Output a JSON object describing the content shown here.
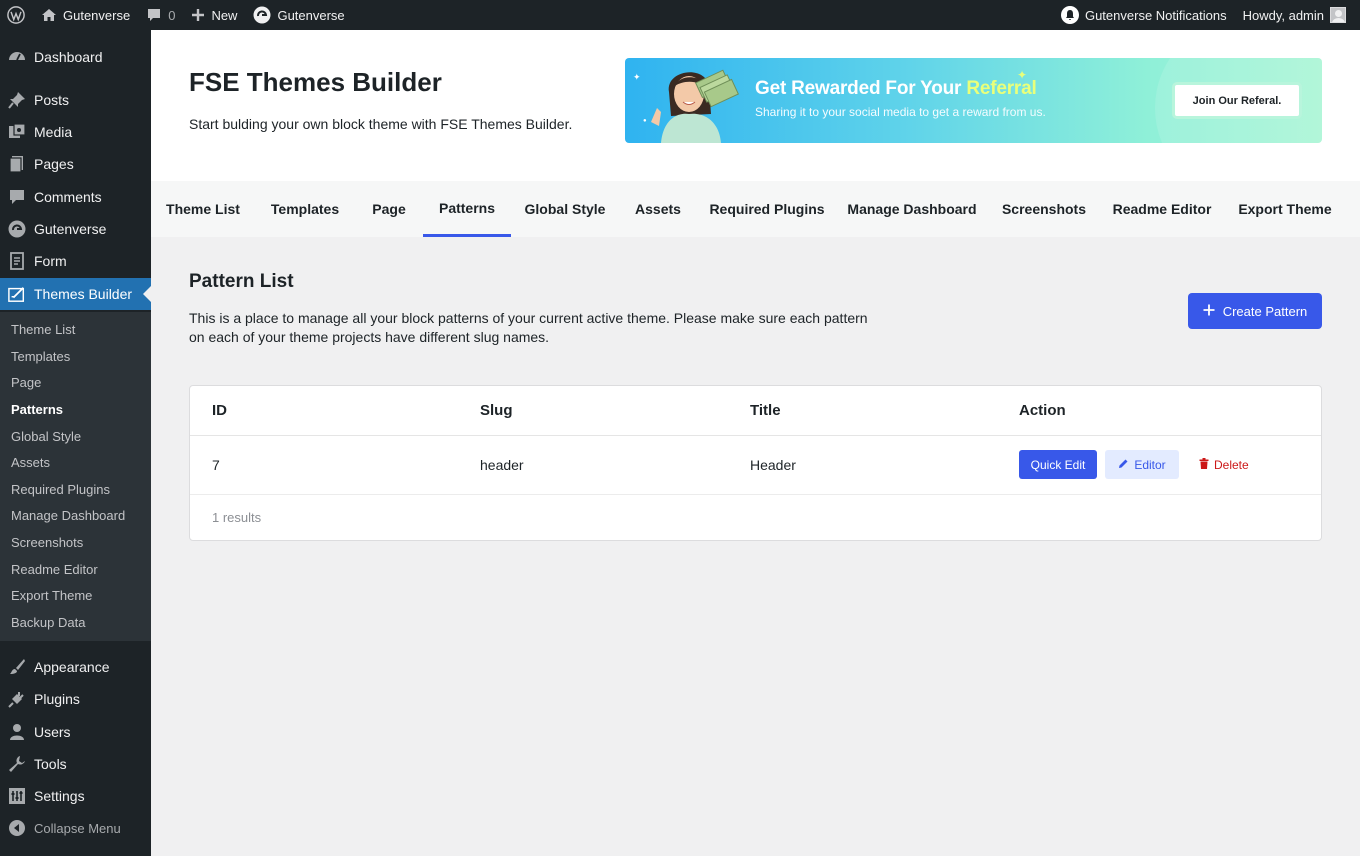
{
  "adminbar": {
    "site_name": "Gutenverse",
    "comments_count": "0",
    "new_label": "New",
    "plugin_label": "Gutenverse",
    "notifications_label": "Gutenverse Notifications",
    "howdy": "Howdy, admin"
  },
  "sidebar": {
    "items": [
      {
        "label": "Dashboard",
        "icon": "dashboard-icon"
      },
      {
        "label": "Posts",
        "icon": "pin-icon"
      },
      {
        "label": "Media",
        "icon": "media-icon"
      },
      {
        "label": "Pages",
        "icon": "page-icon"
      },
      {
        "label": "Comments",
        "icon": "comment-icon"
      },
      {
        "label": "Gutenverse",
        "icon": "gutenverse-icon"
      },
      {
        "label": "Form",
        "icon": "form-icon"
      },
      {
        "label": "Themes Builder",
        "icon": "themes-builder-icon"
      },
      {
        "label": "Appearance",
        "icon": "brush-icon"
      },
      {
        "label": "Plugins",
        "icon": "plug-icon"
      },
      {
        "label": "Users",
        "icon": "user-icon"
      },
      {
        "label": "Tools",
        "icon": "wrench-icon"
      },
      {
        "label": "Settings",
        "icon": "settings-icon"
      },
      {
        "label": "Collapse Menu",
        "icon": "collapse-icon"
      }
    ],
    "submenu": [
      "Theme List",
      "Templates",
      "Page",
      "Patterns",
      "Global Style",
      "Assets",
      "Required Plugins",
      "Manage Dashboard",
      "Screenshots",
      "Readme Editor",
      "Export Theme",
      "Backup Data"
    ]
  },
  "header": {
    "title": "FSE Themes Builder",
    "subtitle": "Start bulding your own block theme with FSE Themes Builder."
  },
  "banner": {
    "title_main": "Get Rewarded For Your ",
    "title_highlight": "Referral",
    "subtitle": "Sharing it to your social media to get a reward from us.",
    "button": "Join Our Referal."
  },
  "tabs": [
    "Theme List",
    "Templates",
    "Page",
    "Patterns",
    "Global Style",
    "Assets",
    "Required Plugins",
    "Manage Dashboard",
    "Screenshots",
    "Readme Editor",
    "Export Theme"
  ],
  "content": {
    "title": "Pattern List",
    "description": "This is a place to manage all your block patterns of your current active theme. Please make sure each pattern on each of your theme projects have different slug names.",
    "create_button": "Create Pattern"
  },
  "table": {
    "columns": [
      "ID",
      "Slug",
      "Title",
      "Action"
    ],
    "rows": [
      {
        "id": "7",
        "slug": "header",
        "title": "Header"
      }
    ],
    "actions": {
      "quick_edit": "Quick Edit",
      "editor": "Editor",
      "delete": "Delete"
    },
    "results": "1 results"
  },
  "colors": {
    "accent": "#3858e9",
    "wp_admin_dark": "#1d2327",
    "wp_active": "#2271b1",
    "delete": "#cc1818"
  }
}
